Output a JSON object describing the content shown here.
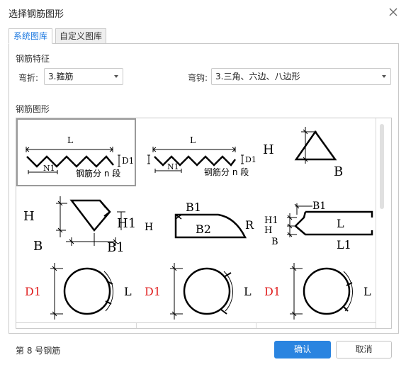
{
  "dialog": {
    "title": "选择钢筋图形"
  },
  "icons": {
    "close": "close-icon",
    "dropdown": "chevron-down-icon"
  },
  "tabs": [
    {
      "label": "系统图库",
      "active": true
    },
    {
      "label": "自定义图库",
      "active": false
    }
  ],
  "features": {
    "section_label": "钢筋特征",
    "bend_label": "弯折:",
    "bend_value": "3.箍筋",
    "hook_label": "弯钩:",
    "hook_value": "3.三角、六边、八边形"
  },
  "shapes": {
    "section_label": "钢筋图形",
    "selected_index": 0,
    "cells": [
      {
        "labels": {
          "l": "L",
          "d1": "D1",
          "n1": "N1",
          "n_text": "钢筋分 n 段"
        }
      },
      {
        "labels": {
          "l": "L",
          "d1": "D1",
          "n1": "N1",
          "n_text": "钢筋分 n 段"
        }
      },
      {
        "labels": {
          "h": "H",
          "b": "B"
        }
      },
      {
        "labels": {
          "h": "H",
          "h1": "H1",
          "b": "B",
          "b1": "B1"
        }
      },
      {
        "labels": {
          "h": "H",
          "b1": "B1",
          "b2": "B2",
          "r": "R"
        }
      },
      {
        "labels": {
          "h1": "H1",
          "h": "H",
          "b": "B",
          "b1": "B1",
          "l": "L",
          "l1": "L1"
        }
      },
      {
        "labels": {
          "d1": "D1",
          "l": "L"
        }
      },
      {
        "labels": {
          "d1": "D1",
          "l": "L"
        }
      },
      {
        "labels": {
          "d1": "D1",
          "l": "L"
        }
      }
    ]
  },
  "colors": {
    "accent": "#2a84e0",
    "tab_active": "#1f7ae0",
    "d1_red": "#e02020"
  },
  "footer": {
    "status": "第 8 号钢筋",
    "ok_label": "确认",
    "cancel_label": "取消"
  }
}
